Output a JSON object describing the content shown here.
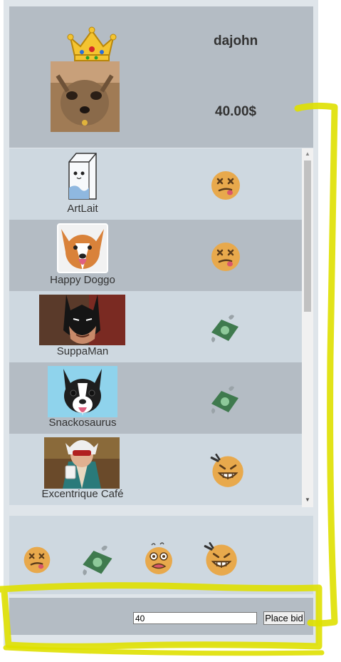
{
  "header": {
    "username": "dajohn",
    "balance": "40.00$",
    "crown_icon": "crown-icon",
    "profile_image": "yorkshire-terrier-photo"
  },
  "players": [
    {
      "name": "ArtLait",
      "avatar": "milk-carton-character",
      "status": "dizzy-face-icon",
      "theme": "light"
    },
    {
      "name": "Happy Doggo",
      "avatar": "corgi-photo",
      "status": "dizzy-face-icon",
      "theme": "dark"
    },
    {
      "name": "SuppaMan",
      "avatar": "batman-photo",
      "status": "flying-money-icon",
      "theme": "light"
    },
    {
      "name": "Snackosaurus",
      "avatar": "boston-terrier-photo",
      "status": "flying-money-icon",
      "theme": "dark"
    },
    {
      "name": "Excentrique Café",
      "avatar": "godot-character-art",
      "status": "grinning-squint-face-icon",
      "theme": "light"
    }
  ],
  "emoji_bar": {
    "emojis": [
      "dizzy-face-icon",
      "flying-money-icon",
      "fearful-face-icon",
      "grinning-squint-face-icon"
    ]
  },
  "bid": {
    "value": "40",
    "button_label": "Place bid"
  },
  "colors": {
    "panel_dark": "#b4bcc4",
    "panel_light": "#ced8e0",
    "background": "#dfe5ea",
    "highlight": "#dfe000"
  }
}
